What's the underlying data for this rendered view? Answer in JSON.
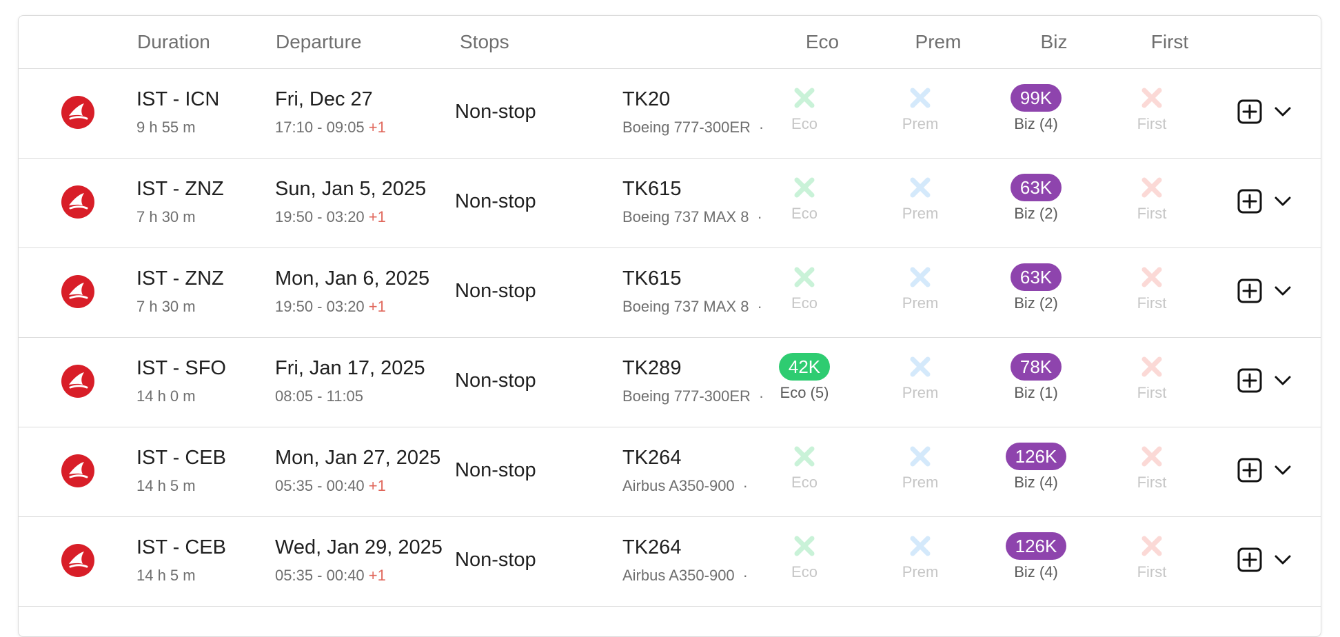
{
  "header": {
    "duration": "Duration",
    "departure": "Departure",
    "stops": "Stops",
    "eco": "Eco",
    "prem": "Prem",
    "biz": "Biz",
    "first": "First"
  },
  "colors": {
    "biz_pill": "#8e44ad",
    "eco_pill": "#2ecc71",
    "eco_x": "#c9f2d8",
    "prem_x": "#d4e9fb",
    "first_x": "#fbd9d6",
    "plus_day": "#e0665a",
    "airline_logo": "#d81e28"
  },
  "icons": {
    "airline": "turkish-airlines-logo",
    "unavailable": "x-icon",
    "add": "plus-square-icon",
    "expand": "chevron-down-icon"
  },
  "flights": [
    {
      "route": "IST - ICN",
      "duration": "9 h 55 m",
      "date": "Fri, Dec 27",
      "time": "17:10 - 09:05",
      "plus": "+1",
      "stops": "Non-stop",
      "flight": "TK20",
      "aircraft": "Boeing 777-300ER",
      "dot": "·",
      "eco": {
        "avail": false,
        "label": "Eco"
      },
      "prem": {
        "avail": false,
        "label": "Prem"
      },
      "biz": {
        "avail": true,
        "price": "99K",
        "label": "Biz (4)"
      },
      "first": {
        "avail": false,
        "label": "First"
      }
    },
    {
      "route": "IST - ZNZ",
      "duration": "7 h 30 m",
      "date": "Sun, Jan 5, 2025",
      "time": "19:50 - 03:20",
      "plus": "+1",
      "stops": "Non-stop",
      "flight": "TK615",
      "aircraft": "Boeing 737 MAX 8",
      "dot": "·",
      "eco": {
        "avail": false,
        "label": "Eco"
      },
      "prem": {
        "avail": false,
        "label": "Prem"
      },
      "biz": {
        "avail": true,
        "price": "63K",
        "label": "Biz (2)"
      },
      "first": {
        "avail": false,
        "label": "First"
      }
    },
    {
      "route": "IST - ZNZ",
      "duration": "7 h 30 m",
      "date": "Mon, Jan 6, 2025",
      "time": "19:50 - 03:20",
      "plus": "+1",
      "stops": "Non-stop",
      "flight": "TK615",
      "aircraft": "Boeing 737 MAX 8",
      "dot": "·",
      "eco": {
        "avail": false,
        "label": "Eco"
      },
      "prem": {
        "avail": false,
        "label": "Prem"
      },
      "biz": {
        "avail": true,
        "price": "63K",
        "label": "Biz (2)"
      },
      "first": {
        "avail": false,
        "label": "First"
      }
    },
    {
      "route": "IST - SFO",
      "duration": "14 h 0 m",
      "date": "Fri, Jan 17, 2025",
      "time": "08:05 - 11:05",
      "plus": "",
      "stops": "Non-stop",
      "flight": "TK289",
      "aircraft": "Boeing 777-300ER",
      "dot": "·",
      "eco": {
        "avail": true,
        "price": "42K",
        "label": "Eco (5)"
      },
      "prem": {
        "avail": false,
        "label": "Prem"
      },
      "biz": {
        "avail": true,
        "price": "78K",
        "label": "Biz (1)"
      },
      "first": {
        "avail": false,
        "label": "First"
      }
    },
    {
      "route": "IST - CEB",
      "duration": "14 h 5 m",
      "date": "Mon, Jan 27, 2025",
      "time": "05:35 - 00:40",
      "plus": "+1",
      "stops": "Non-stop",
      "flight": "TK264",
      "aircraft": "Airbus A350-900",
      "dot": "·",
      "eco": {
        "avail": false,
        "label": "Eco"
      },
      "prem": {
        "avail": false,
        "label": "Prem"
      },
      "biz": {
        "avail": true,
        "price": "126K",
        "label": "Biz (4)"
      },
      "first": {
        "avail": false,
        "label": "First"
      }
    },
    {
      "route": "IST - CEB",
      "duration": "14 h 5 m",
      "date": "Wed, Jan 29, 2025",
      "time": "05:35 - 00:40",
      "plus": "+1",
      "stops": "Non-stop",
      "flight": "TK264",
      "aircraft": "Airbus A350-900",
      "dot": "·",
      "eco": {
        "avail": false,
        "label": "Eco"
      },
      "prem": {
        "avail": false,
        "label": "Prem"
      },
      "biz": {
        "avail": true,
        "price": "126K",
        "label": "Biz (4)"
      },
      "first": {
        "avail": false,
        "label": "First"
      }
    }
  ]
}
